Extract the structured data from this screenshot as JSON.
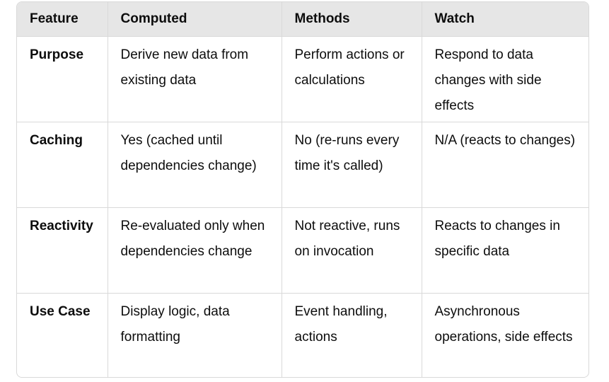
{
  "table": {
    "headers": [
      "Feature",
      "Computed",
      "Methods",
      "Watch"
    ],
    "rows": [
      [
        "Purpose",
        "Derive new data from existing data",
        "Perform actions or calculations",
        "Respond to data changes with side effects"
      ],
      [
        "Caching",
        "Yes (cached until dependencies change)",
        "No (re-runs every time it's called)",
        "N/A (reacts to changes)"
      ],
      [
        "Reactivity",
        "Re-evaluated only when dependencies change",
        "Not reactive, runs on invocation",
        "Reacts to changes in specific data"
      ],
      [
        "Use Case",
        "Display logic, data formatting",
        "Event handling, actions",
        "Asynchronous operations, side effects"
      ]
    ]
  },
  "colors": {
    "header_bg": "#e6e6e6",
    "border": "#d9d9d9",
    "text": "#0d0d0d"
  }
}
